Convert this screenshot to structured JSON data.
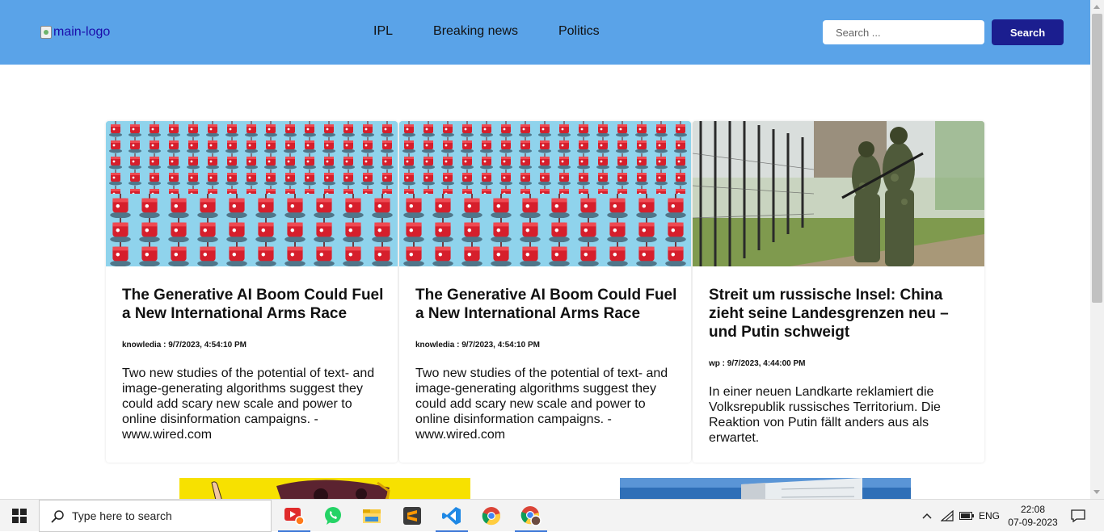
{
  "header": {
    "logo_alt": "main-logo",
    "nav": [
      "IPL",
      "Breaking news",
      "Politics"
    ],
    "search_placeholder": "Search ...",
    "search_button": "Search"
  },
  "articles": [
    {
      "title": "The Generative AI Boom Could Fuel a New International Arms Race",
      "meta": "knowledia : 9/7/2023, 4:54:10 PM",
      "description": "Two new studies of the potential of text- and image-generating algorithms suggest they could add scary new scale and power to online disinformation campaigns. - www.wired.com",
      "image": "robots"
    },
    {
      "title": "The Generative AI Boom Could Fuel a New International Arms Race",
      "meta": "knowledia : 9/7/2023, 4:54:10 PM",
      "description": "Two new studies of the potential of text- and image-generating algorithms suggest they could add scary new scale and power to online disinformation campaigns. - www.wired.com",
      "image": "robots"
    },
    {
      "title": "Streit um russische Insel: China zieht seine Landesgrenzen neu – und Putin schweigt",
      "meta": "wp : 9/7/2023, 4:44:00 PM",
      "description": "In einer neuen Landkarte reklamiert die Volksrepublik russisches Territorium. Die Reaktion von Putin fällt anders aus als erwartet.",
      "image": "soldiers-border-fence"
    }
  ],
  "colors": {
    "navbar": "#5aa3e8",
    "search_button": "#1b1e8f"
  },
  "taskbar": {
    "search_placeholder": "Type here to search",
    "apps": [
      "screen-recorder-icon",
      "whatsapp-icon",
      "file-explorer-icon",
      "sublime-text-icon",
      "vscode-icon",
      "chrome-icon",
      "chrome-profile-icon"
    ],
    "language": "ENG",
    "time": "22:08",
    "date": "07-09-2023"
  }
}
